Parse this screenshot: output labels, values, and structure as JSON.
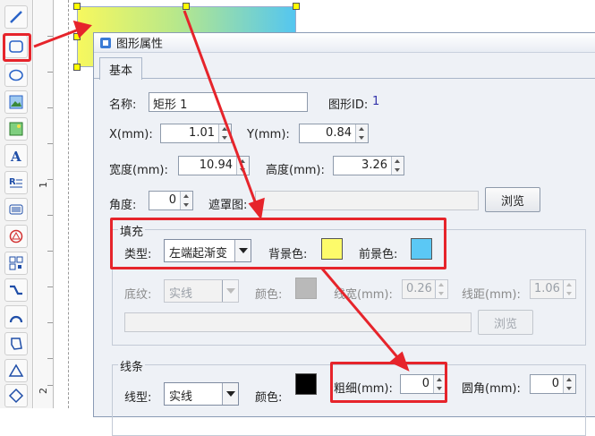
{
  "colors": {
    "accent_red": "#e6242b",
    "gradient_start": "#f7f85e",
    "gradient_end": "#54c6f0",
    "bg_color": "#fdfb6a",
    "fg_color": "#5bc8f5",
    "texture_color": "#b9b9b9",
    "line_color": "#000000"
  },
  "toolbar": {
    "icons": [
      "line-icon",
      "rounded-rect-icon",
      "ellipse-icon",
      "image-icon",
      "picture-icon",
      "text-icon",
      "rich-text-icon",
      "barcode-icon",
      "seal-icon",
      "qrcode-icon",
      "curve-icon",
      "arc-icon",
      "polygon-icon",
      "triangle-icon",
      "diamond-icon"
    ]
  },
  "ruler": {
    "marks": [
      "1",
      "2"
    ]
  },
  "dialog": {
    "title": "图形属性",
    "tab_basic": "基本",
    "name_label": "名称:",
    "name_value": "矩形 1",
    "id_label": "图形ID:",
    "id_value": "1",
    "x_label": "X(mm):",
    "x_value": "1.01",
    "y_label": "Y(mm):",
    "y_value": "0.84",
    "width_label": "宽度(mm):",
    "width_value": "10.94",
    "height_label": "高度(mm):",
    "height_value": "3.26",
    "angle_label": "角度:",
    "angle_value": "0",
    "mask_label": "遮罩图:",
    "browse_label": "浏览",
    "fill": {
      "title": "填充",
      "type_label": "类型:",
      "type_value": "左端起渐变",
      "bg_label": "背景色:",
      "fg_label": "前景色:",
      "texture_label": "底纹:",
      "texture_value": "实线",
      "color_label": "颜色:",
      "linewidth_label": "线宽(mm):",
      "linewidth_value": "0.26",
      "linegap_label": "线距(mm):",
      "linegap_value": "1.06",
      "browse_label": "浏览"
    },
    "stroke": {
      "title": "线条",
      "style_label": "线型:",
      "style_value": "实线",
      "color_label": "颜色:",
      "thickness_label": "粗细(mm):",
      "thickness_value": "0",
      "corner_label": "圆角(mm):",
      "corner_value": "0"
    }
  }
}
